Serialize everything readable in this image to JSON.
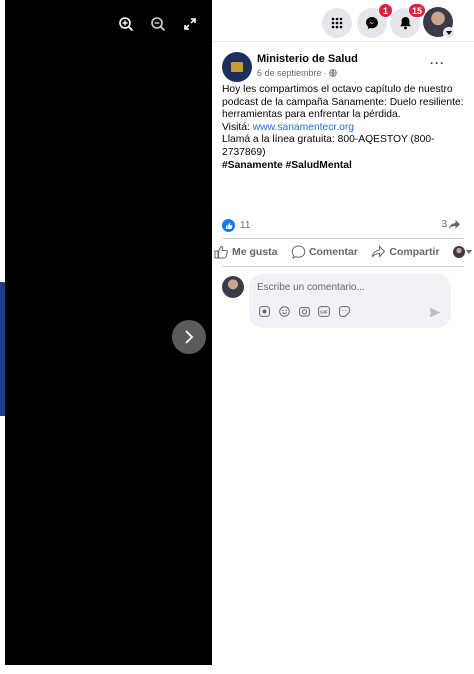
{
  "topbar": {
    "messenger_badge": "1",
    "notifications_badge": "15"
  },
  "post": {
    "page_name": "Ministerio de Salud",
    "date": "6 de septiembre",
    "meta_separator": "·",
    "text_line1": "Hoy les compartimos el octavo capítulo de nuestro podcast de la campaña Sanamente: Duelo resiliente: herramientas para enfrentar la pérdida.",
    "visit_label": "Visitá: ",
    "visit_link": "www.sanamentecr.org",
    "phone_line": "Llamá a la línea gratuita: 800-AQESTOY (800-2737869)",
    "hashtags": "#Sanamente #SaludMental",
    "reaction_count": "11",
    "share_count": "3"
  },
  "actions": {
    "like": "Me gusta",
    "comment": "Comentar",
    "share": "Compartir"
  },
  "comment": {
    "placeholder": "Escribe un comentario..."
  },
  "colors": {
    "accent": "#1877f2",
    "badge": "#e41e3f",
    "link": "#216fdb"
  }
}
